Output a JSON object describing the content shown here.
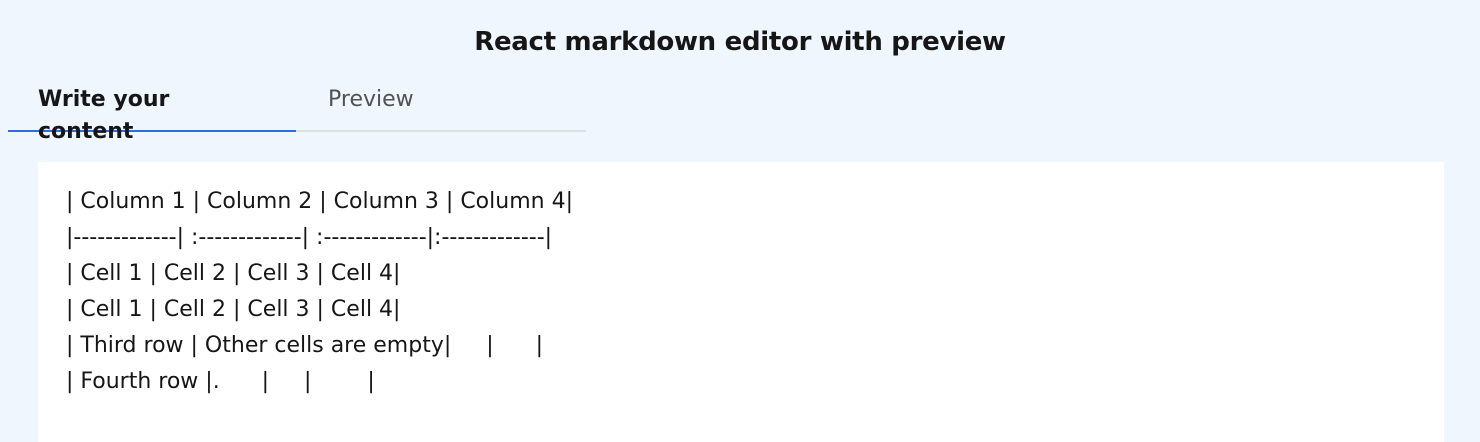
{
  "header": {
    "title": "React markdown editor with preview"
  },
  "tabs": [
    {
      "label": "Write your content",
      "active": true
    },
    {
      "label": "Preview",
      "active": false
    }
  ],
  "editor": {
    "content": "| Column 1 | Column 2 | Column 3 | Column 4|\n|-------------| :-------------| :-------------|:-------------|\n| Cell 1 | Cell 2 | Cell 3 | Cell 4|\n| Cell 1 | Cell 2 | Cell 3 | Cell 4|\n| Third row | Other cells are empty|     |      |\n| Fourth row |.      |     |        |"
  },
  "colors": {
    "background": "#eff6fe",
    "active_tab_underline": "#2f6ddc",
    "tab_divider": "#e0e0e0",
    "editor_background": "#ffffff"
  }
}
